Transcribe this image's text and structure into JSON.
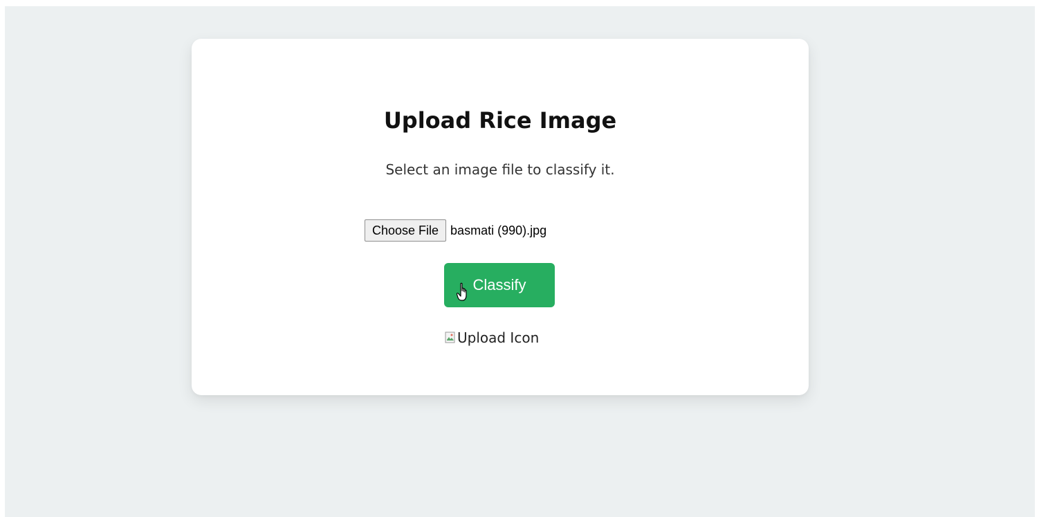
{
  "page": {
    "title": "Upload Rice Image",
    "subtitle": "Select an image file to classify it.",
    "file_input": {
      "button_label": "Choose File",
      "selected_file": "basmati (990).jpg"
    },
    "classify_button": {
      "label": "Classify",
      "color": "#27ae60"
    },
    "upload_image": {
      "alt": "Upload Icon"
    }
  },
  "colors": {
    "background": "#ecf0f1",
    "card": "#ffffff"
  },
  "icons": {
    "cursor": "hand-pointer-icon",
    "broken_image": "broken-image-icon"
  }
}
